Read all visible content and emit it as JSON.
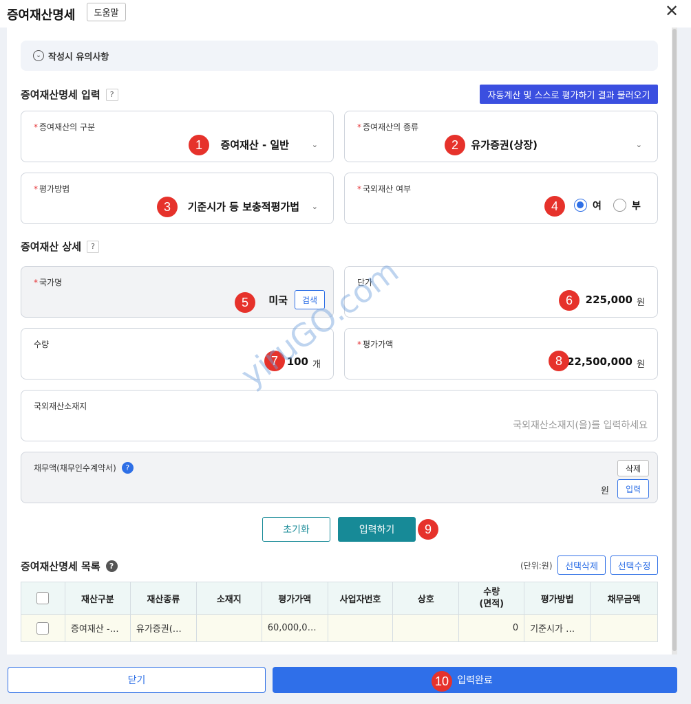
{
  "header": {
    "title": "증여재산명세",
    "help_label": "도움말",
    "close_glyph": "✕"
  },
  "notice": {
    "label": "작성시 유의사항"
  },
  "input_section": {
    "title": "증여재산명세 입력",
    "help": "?",
    "auto_button": "자동계산 및 스스로 평가하기 결과 불러오기",
    "category": {
      "label": "증여재산의 구분",
      "value": "증여재산 - 일반"
    },
    "kind": {
      "label": "증여재산의 종류",
      "value": "유가증권(상장)"
    },
    "method": {
      "label": "평가방법",
      "value": "기준시가 등 보충적평가법"
    },
    "foreign": {
      "label": "국외재산 여부",
      "options": [
        "여",
        "부"
      ],
      "selected": "여"
    }
  },
  "detail_section": {
    "title": "증여재산 상세",
    "help": "?",
    "country": {
      "label": "국가명",
      "value": "미국",
      "search_button": "검색"
    },
    "unit_price": {
      "label": "단가",
      "value": "225,000",
      "unit": "원"
    },
    "quantity": {
      "label": "수량",
      "value": "100",
      "unit": "개"
    },
    "appraised": {
      "label": "평가가액",
      "value": "22,500,000",
      "unit": "원"
    },
    "location": {
      "label": "국외재산소재지",
      "placeholder": "국외재산소재지(을)를 입력하세요"
    },
    "debt": {
      "label": "채무액(채무인수계약서)",
      "help": "?",
      "delete_button": "삭제",
      "unit": "원",
      "input_button": "입력"
    }
  },
  "actions": {
    "reset": "초기화",
    "submit": "입력하기"
  },
  "list_section": {
    "title": "증여재산명세 목록",
    "help": "?",
    "unit_note": "(단위:원)",
    "delete_selected": "선택삭제",
    "edit_selected": "선택수정",
    "columns": [
      "재산구분",
      "재산종류",
      "소재지",
      "평가가액",
      "사업자번호",
      "상호",
      "수량\n(면적)",
      "평가방법",
      "채무금액"
    ],
    "rows": [
      [
        "증여재산 -…",
        "유가증권(…",
        "",
        "60,000,0…",
        "",
        "",
        "0",
        "기준시가 …",
        ""
      ]
    ]
  },
  "footer": {
    "close": "닫기",
    "done": "입력완료"
  },
  "badges": [
    "1",
    "2",
    "3",
    "4",
    "5",
    "6",
    "7",
    "8",
    "9",
    "10"
  ],
  "watermark": "yiruGO.com",
  "colors": {
    "primary": "#2f6fe9",
    "teal": "#178a97",
    "badge": "#e6322b",
    "required": "#e5383b"
  }
}
